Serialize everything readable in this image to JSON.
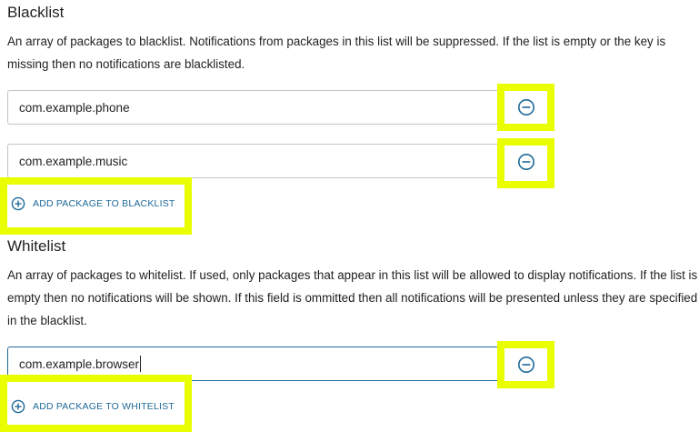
{
  "blacklist": {
    "title": "Blacklist",
    "description": "An array of packages to blacklist. Notifications from packages in this list will be suppressed. If the list is empty or the key is missing then no notifications are blacklisted.",
    "items": [
      {
        "value": "com.example.phone"
      },
      {
        "value": "com.example.music"
      }
    ],
    "add_label": "ADD PACKAGE TO BLACKLIST"
  },
  "whitelist": {
    "title": "Whitelist",
    "description": "An array of packages to whitelist. If used, only packages that appear in this list will be allowed to display notifications. If the list is empty then no notifications will be shown. If this field is ommitted then all notifications will be presented unless they are specified in the blacklist.",
    "items": [
      {
        "value": "com.example.browser"
      }
    ],
    "add_label": "ADD PACKAGE TO WHITELIST"
  },
  "icons": {
    "remove": "minus-circle-icon",
    "add": "plus-circle-icon"
  },
  "colors": {
    "accent": "#1f6a99",
    "highlight": "#e9ff00",
    "input_border": "#c4c4c4"
  }
}
